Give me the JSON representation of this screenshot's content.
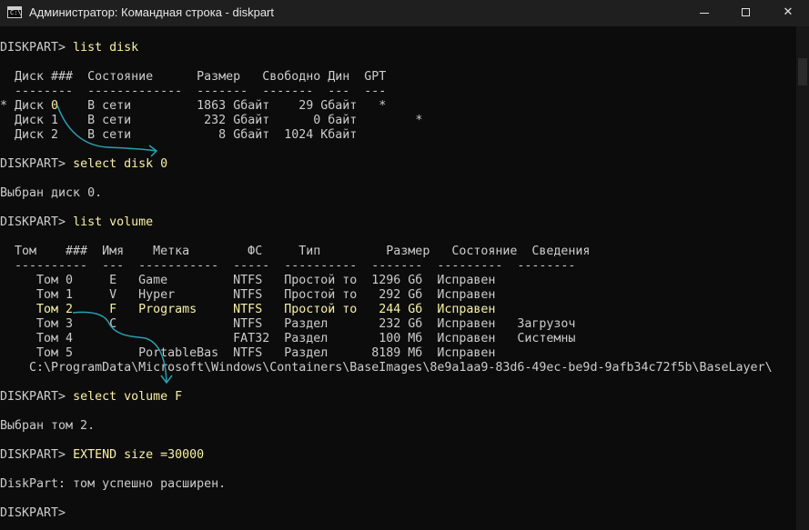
{
  "window": {
    "icon_text": "C:\\",
    "title": "Администратор: Командная строка - diskpart",
    "minimize": "—",
    "maximize": "☐",
    "close": "✕"
  },
  "prompt": "DISKPART> ",
  "console": {
    "cmd_list_disk": "list disk",
    "disk_header": "  Диск ###  Состояние      Размер   Свободно Дин  GPT",
    "disk_sep": "  --------  -------------  -------  -------  ---  ---",
    "disk_rows": [
      {
        "prefix": "* Диск ",
        "num": "0",
        "rest": "    В сети         1863 Gбайт    29 Gбайт   *"
      },
      {
        "prefix": "  Диск ",
        "num": "1",
        "rest": "    В сети          232 Gбайт      0 байт        *"
      },
      {
        "prefix": "  Диск ",
        "num": "2",
        "rest": "    В сети            8 Gбайт  1024 Kбайт"
      }
    ],
    "cmd_select_disk": "select disk 0",
    "msg_disk_selected": "Выбран диск 0.",
    "cmd_list_volume": "list volume",
    "vol_header": "  Том    ###  Имя    Метка        ФС     Тип         Размер   Состояние  Сведения",
    "vol_sep": "  ----------  ---  -----------  -----  ----------  -------  ---------  --------",
    "volumes": [
      "     Том 0     E   Game         NTFS   Простой то  1296 Gб  Исправен",
      "     Том 1     V   Hyper        NTFS   Простой то   292 Gб  Исправен",
      "     Том 2     F   Programs     NTFS   Простой то   244 Gб  Исправен",
      "     Том 3     C                NTFS   Раздел       232 Gб  Исправен   Загрузоч",
      "     Том 4                      FAT32  Раздел       100 Mб  Исправен   Системны",
      "     Том 5         PortableBas  NTFS   Раздел      8189 Mб  Исправен"
    ],
    "vol5_path": "    C:\\ProgramData\\Microsoft\\Windows\\Containers\\BaseImages\\8e9a1aa9-83d6-49ec-be9d-9afb34c72f5b\\BaseLayer\\",
    "cmd_select_volume": "select volume F",
    "msg_volume_selected": "Выбран том 2.",
    "cmd_extend": "EXTEND size =30000",
    "msg_extended": "DiskPart: том успешно расширен.",
    "final_prompt": "DISKPART>"
  },
  "colors": {
    "background": "#0c0c0c",
    "text": "#cccccc",
    "input": "#f9f1a5",
    "annotation": "#2a9fb0"
  }
}
